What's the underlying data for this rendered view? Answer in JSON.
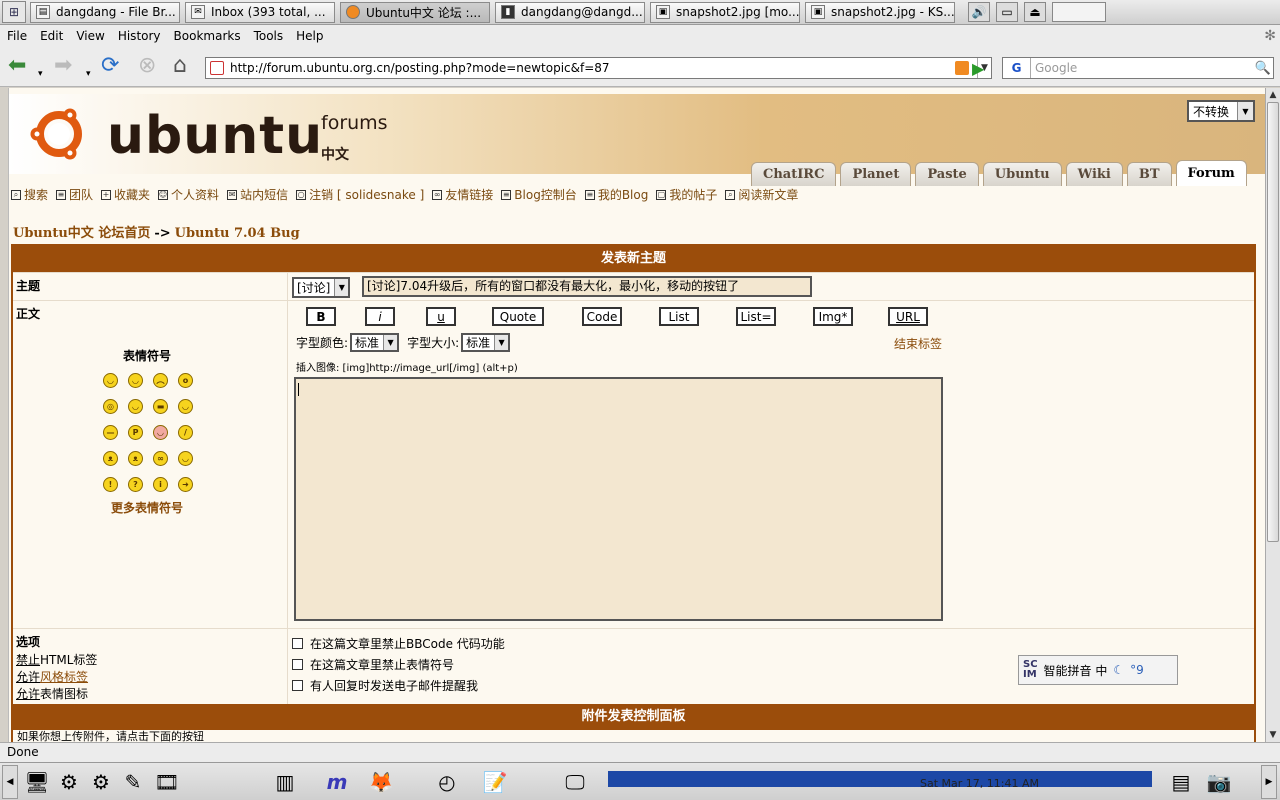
{
  "taskbar": {
    "tasks": [
      {
        "label": "dangdang - File Br...",
        "icon": "folder-icon"
      },
      {
        "label": "Inbox (393 total, ...",
        "icon": "mail-icon"
      },
      {
        "label": "Ubuntu中文 论坛 :...",
        "icon": "firefox-icon"
      },
      {
        "label": "dangdang@dangd...",
        "icon": "terminal-icon"
      },
      {
        "label": "snapshot2.jpg [mo...",
        "icon": "image-icon"
      },
      {
        "label": "snapshot2.jpg - KS...",
        "icon": "image-icon"
      }
    ]
  },
  "menubar": {
    "items": [
      "File",
      "Edit",
      "View",
      "History",
      "Bookmarks",
      "Tools",
      "Help"
    ]
  },
  "navbar": {
    "url": "http://forum.ubuntu.org.cn/posting.php?mode=newtopic&f=87",
    "search_placeholder": "Google",
    "search_engine": "G"
  },
  "header": {
    "logo_word": "ubuntu",
    "logo_forums": "forums",
    "logo_cn": "中文",
    "lang_select": "不转换",
    "tabs": [
      "ChatIRC",
      "Planet",
      "Paste",
      "Ubuntu",
      "Wiki",
      "BT",
      "Forum"
    ],
    "active_tab": "Forum"
  },
  "toplinks": [
    "搜索",
    "团队",
    "收藏夹",
    "个人资料",
    "站内短信",
    "注销 [ solidesnake ]",
    "友情链接",
    "Blog控制台",
    "我的Blog",
    "我的帖子",
    "阅读新文章"
  ],
  "breadcrumb": {
    "home": "Ubuntu中文 论坛首页",
    "sep": "->",
    "current": "Ubuntu 7.04 Bug"
  },
  "form": {
    "title": "发表新主题",
    "subject_label": "主题",
    "subject_type": "[讨论]",
    "subject_value": "[讨论]7.04升级后，所有的窗口都没有最大化，最小化，移动的按钮了",
    "body_label": "正文",
    "smilies_title": "表情符号",
    "more_smilies": "更多表情符号",
    "smilies": [
      "😄",
      "😀",
      "🙁",
      "😮",
      "😵",
      "🙂",
      "😎",
      "😆",
      "😐",
      "😛",
      "😊",
      "😕",
      "😈",
      "😈",
      "🙄",
      "🙂",
      "❗",
      "❓",
      "💡",
      "➡"
    ],
    "bbcode_buttons": [
      "B",
      "i",
      "u",
      "Quote",
      "Code",
      "List",
      "List=",
      "Img*",
      "URL"
    ],
    "font_color_label": "字型颜色:",
    "font_color_value": "标准",
    "font_size_label": "字型大小:",
    "font_size_value": "标准",
    "close_tags": "结束标签",
    "img_hint": "插入图像: [img]http://image_url[/img]  (alt+p)",
    "options_label": "选项",
    "opt_html": "禁止",
    "opt_html_rest": "HTML标签",
    "opt_bbcode_pre": "允许",
    "opt_bbcode": "风格标签",
    "opt_smilies_pre": "允许",
    "opt_smilies_rest": "表情图标",
    "checks": [
      "在这篇文章里禁止BBCode 代码功能",
      "在这篇文章里禁止表情符号",
      "有人回复时发送电子邮件提醒我"
    ],
    "attach_title": "附件发表控制面板",
    "tail_text": "如果你想上传附件，请点击下面的按钮"
  },
  "ime": {
    "label": "智能拼音 中"
  },
  "status": "Done",
  "clock": "Sat Mar 17, 11:41 AM",
  "colors": {
    "header_brown": "#9b4d0b",
    "link_brown": "#8b4c0a",
    "textarea_bg": "#f3e7d0",
    "panel_blue": "#1d48a6"
  }
}
